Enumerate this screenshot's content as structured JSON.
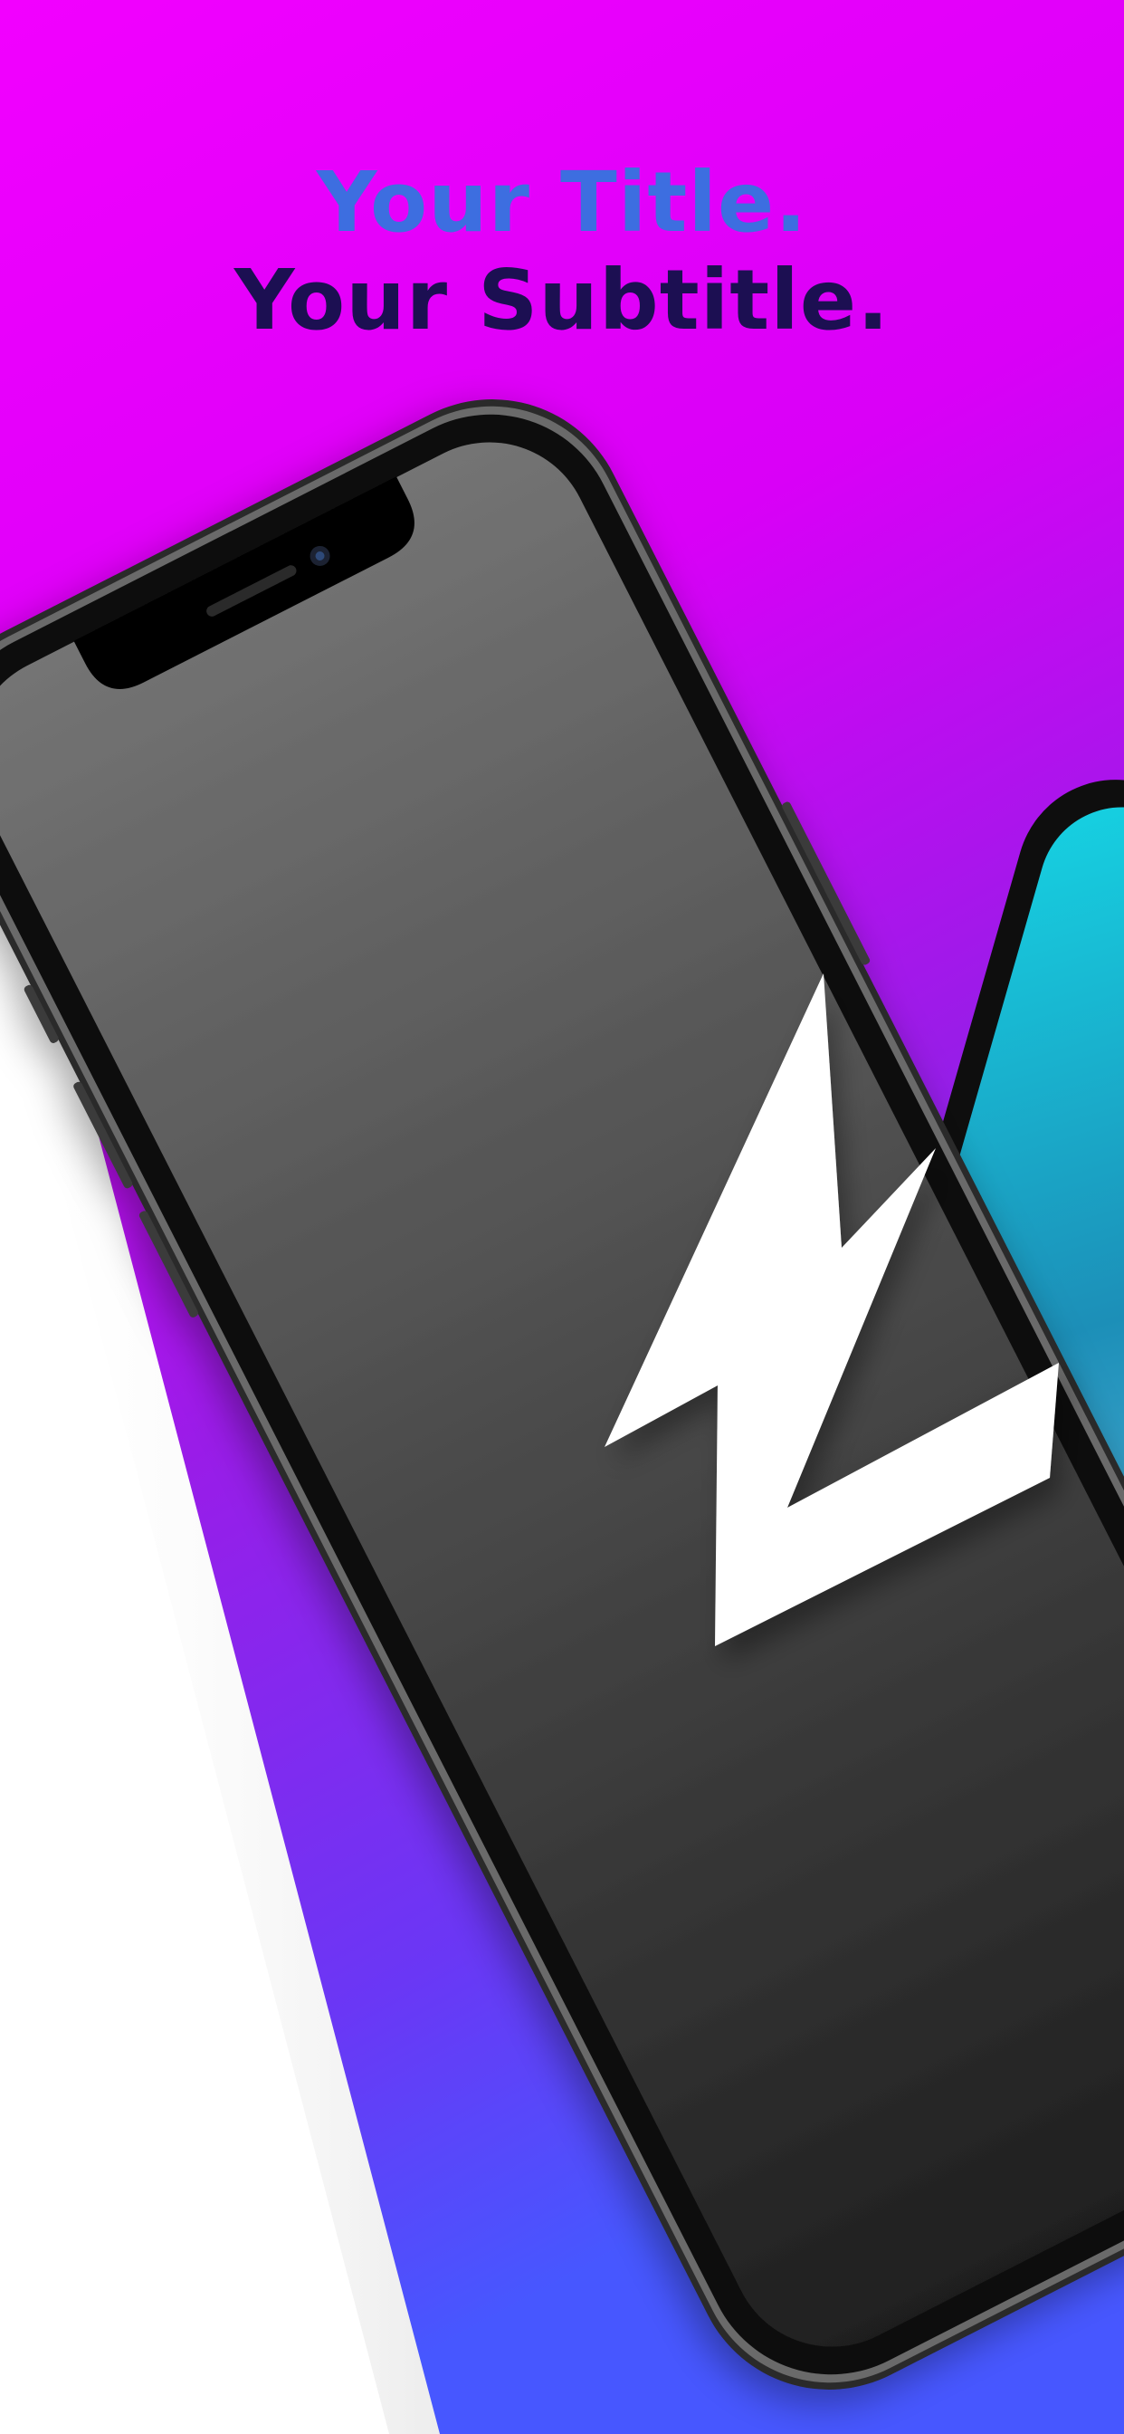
{
  "headline": {
    "title": "Your Title.",
    "subtitle": "Your Subtitle."
  },
  "colors": {
    "background": "#ffffff",
    "gradient_top": "#f200ff",
    "gradient_mid": "#a317ee",
    "gradient_bottom": "#4757ff",
    "title": "#3d6ee0",
    "subtitle": "#1c0f52",
    "phone_frame": "#0c0c0c",
    "phone_rim": "#5a5a5a",
    "screen_top": "#727272",
    "screen_bottom": "#1f1f1f",
    "bolt": "#ffffff",
    "second_screen_top": "#16d3e3",
    "second_screen_bottom": "#6fc4ea"
  },
  "icons": {
    "front_phone": "smartphone-icon",
    "screen_logo": "lightning-bolt-icon",
    "back_phone": "smartphone-icon"
  }
}
